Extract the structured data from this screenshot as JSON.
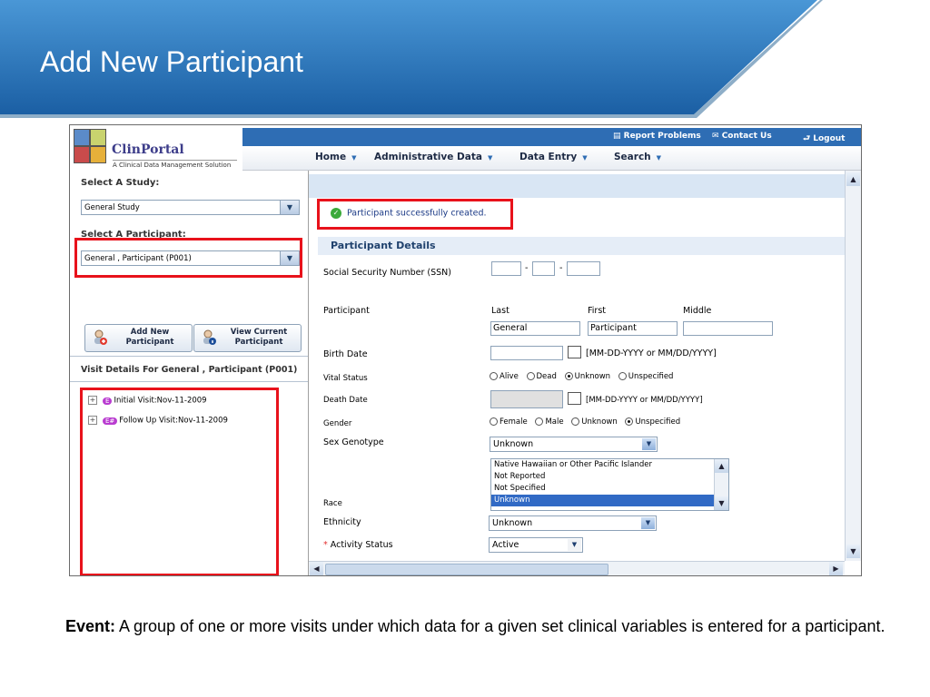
{
  "slide": {
    "title": "Add New Participant",
    "caption_term": "Event:",
    "caption_text": " A group of one or more visits under which data for a given set  clinical variables is entered for a participant."
  },
  "app": {
    "logo_name": "ClinPortal",
    "logo_tagline": "A Clinical Data Management Solution",
    "util_links": [
      "Report Problems",
      "Contact Us",
      "Logout"
    ],
    "menu": [
      "Home",
      "Administrative Data",
      "Data Entry",
      "Search"
    ]
  },
  "left": {
    "study_heading": "Select A Study:",
    "study_value": "General Study",
    "participant_heading": "Select A Participant:",
    "participant_value": "General , Participant (P001)",
    "add_btn": "Add New Participant",
    "view_btn": "View Current Participant",
    "visit_heading": "Visit Details For  General , Participant (P001)",
    "visits": [
      {
        "badge": "E",
        "label": "Initial Visit:Nov-11-2009"
      },
      {
        "badge": "E#",
        "label": "Follow Up Visit:Nov-11-2009"
      }
    ]
  },
  "form": {
    "success": "Participant successfully created.",
    "section": "Participant Details",
    "ssn_label": "Social Security Number (SSN)",
    "participant_label": "Participant",
    "name_headers": [
      "Last",
      "First",
      "Middle"
    ],
    "name_values": [
      "General",
      "Participant",
      ""
    ],
    "birth_label": "Birth Date",
    "birth_hint": "[MM-DD-YYYY or MM/DD/YYYY]",
    "vital_label": "Vital Status",
    "vital_options": [
      "Alive",
      "Dead",
      "Unknown",
      "Unspecified"
    ],
    "vital_selected": "Unknown",
    "death_label": "Death Date",
    "death_hint": "[MM-DD-YYYY or MM/DD/YYYY]",
    "gender_label": "Gender",
    "gender_options": [
      "Female",
      "Male",
      "Unknown",
      "Unspecified"
    ],
    "gender_selected": "Unspecified",
    "sexgeno_label": "Sex Genotype",
    "sexgeno_value": "Unknown",
    "race_label": "Race",
    "race_options": [
      "Native Hawaiian or Other Pacific Islander",
      "Not Reported",
      "Not Specified",
      "Unknown"
    ],
    "race_selected": "Unknown",
    "ethnicity_label": "Ethnicity",
    "ethnicity_value": "Unknown",
    "activity_label": "Activity Status",
    "activity_required": "*",
    "activity_value": "Active"
  },
  "colors": {
    "banner": "#1f6fb5",
    "accent_red": "#e8121b",
    "menu_blue": "#2e6db4"
  }
}
